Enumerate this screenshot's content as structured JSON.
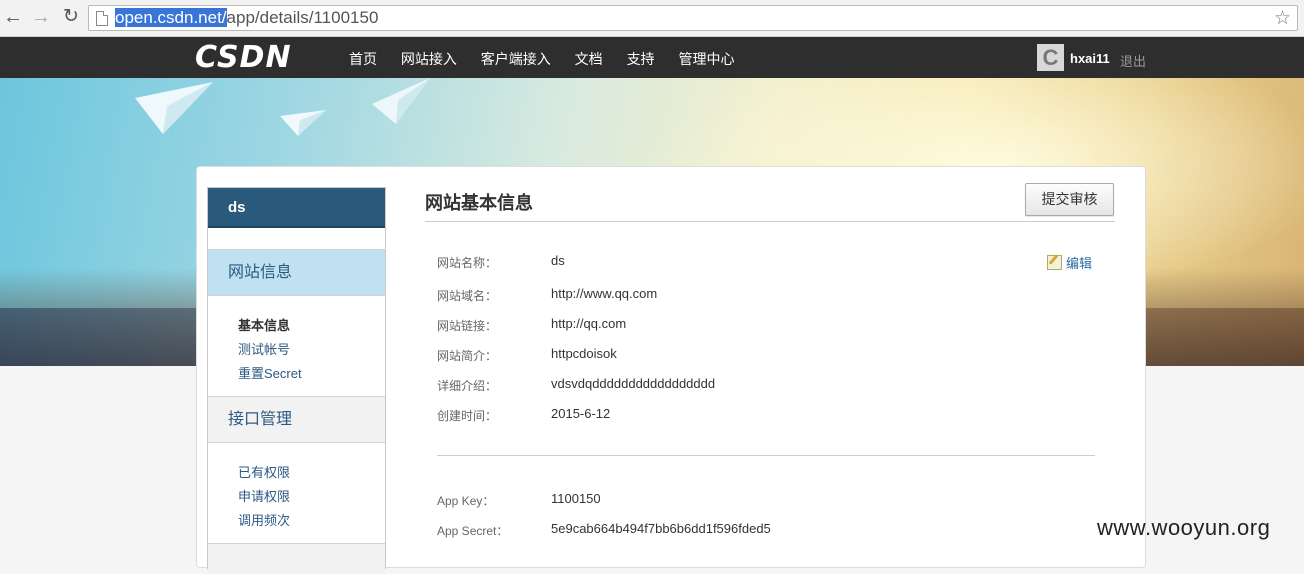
{
  "browser": {
    "url_host": "open.csdn.net/",
    "url_path": "app/details/1100150"
  },
  "header": {
    "logo": "CSDN",
    "menu": [
      "首页",
      "网站接入",
      "客户端接入",
      "文档",
      "支持",
      "管理中心"
    ],
    "avatar_letter": "C",
    "username": "hxai11",
    "logout": "退出"
  },
  "sidebar": {
    "title": "ds",
    "section1": "网站信息",
    "section1_links": [
      "基本信息",
      "测试帐号",
      "重置Secret"
    ],
    "section2": "接口管理",
    "section2_links": [
      "已有权限",
      "申请权限",
      "调用频次"
    ]
  },
  "main": {
    "title": "网站基本信息",
    "submit": "提交审核",
    "edit": "编辑",
    "rows": [
      {
        "label": "网站名称：",
        "value": "ds"
      },
      {
        "label": "网站域名：",
        "value": "http://www.qq.com"
      },
      {
        "label": "网站链接：",
        "value": "http://qq.com"
      },
      {
        "label": "网站简介：",
        "value": "httpcdoisok"
      },
      {
        "label": "详细介绍：",
        "value": "vdsvdqddddddddddddddddd"
      },
      {
        "label": "创建时间：",
        "value": "2015-6-12"
      }
    ],
    "keys": [
      {
        "label": "App Key：",
        "value": "1100150"
      },
      {
        "label": "App Secret：",
        "value": "5e9cab664b494f7bb6b6dd1f596fded5"
      }
    ]
  },
  "watermark": "www.wooyun.org"
}
